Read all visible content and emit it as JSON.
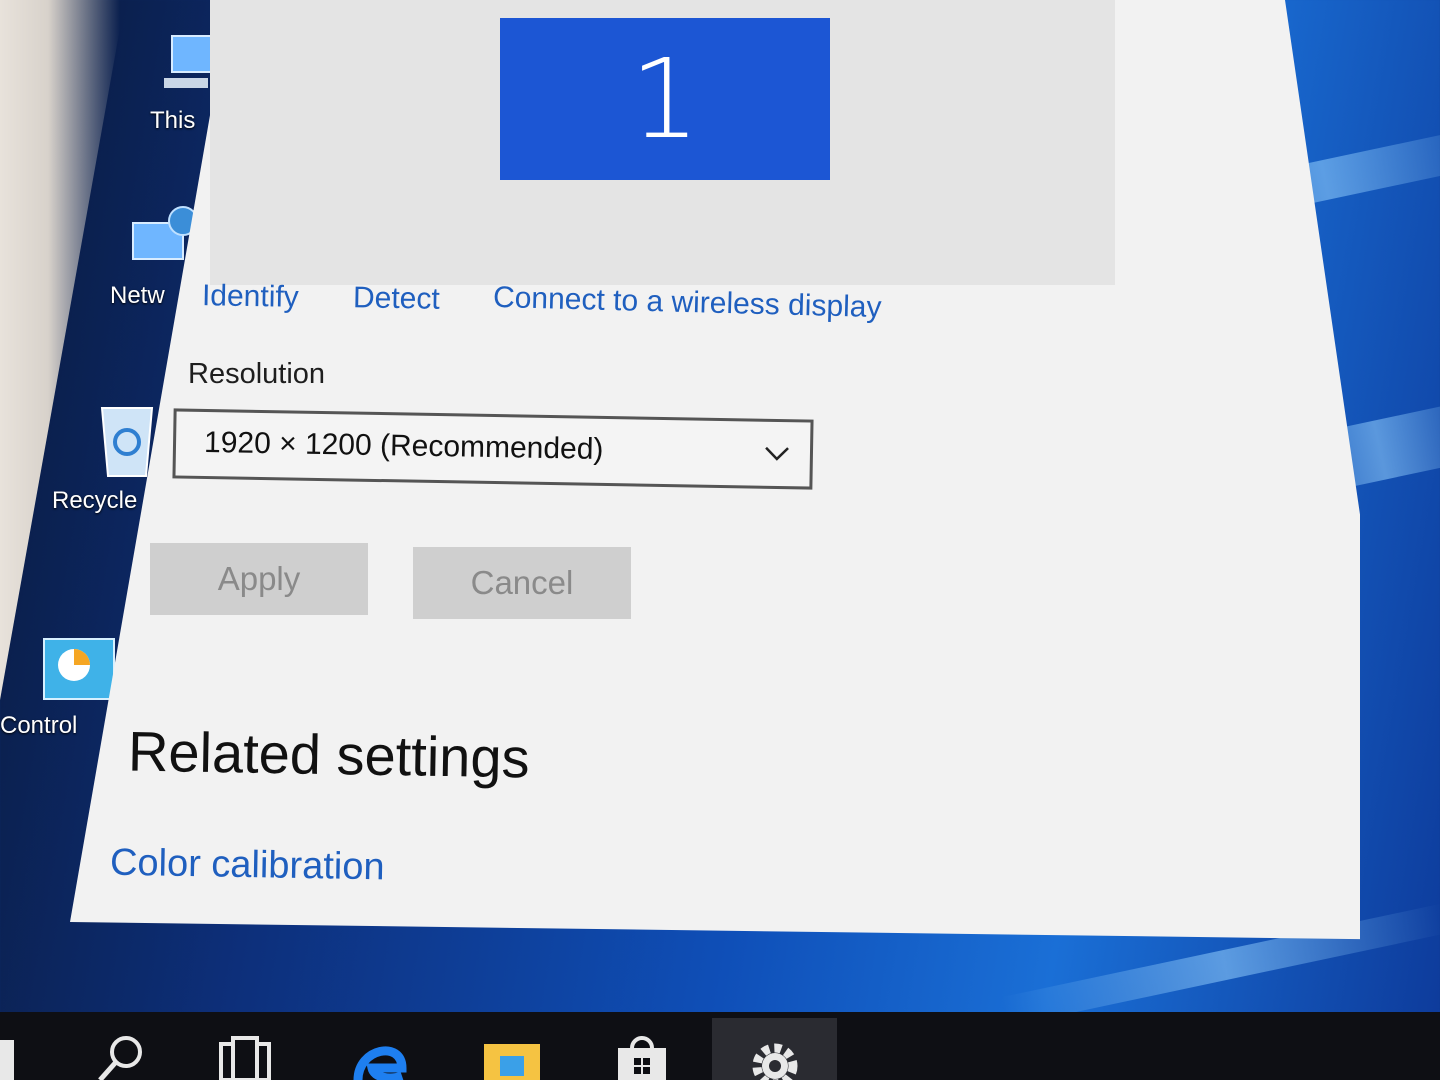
{
  "desktop": {
    "icons": [
      {
        "label": "This"
      },
      {
        "label": "Netw"
      },
      {
        "label": "Recycle"
      },
      {
        "label": "Control"
      }
    ]
  },
  "display_settings": {
    "monitor_number": "1",
    "links": {
      "identify": "Identify",
      "detect": "Detect",
      "connect_wireless": "Connect to a wireless display"
    },
    "resolution": {
      "label": "Resolution",
      "selected": "1920 × 1200 (Recommended)"
    },
    "buttons": {
      "apply": "Apply",
      "cancel": "Cancel"
    },
    "related": {
      "heading": "Related settings",
      "color_calibration": "Color calibration"
    }
  },
  "taskbar": {
    "items": [
      "start-icon",
      "search-icon",
      "task-view-icon",
      "edge-icon",
      "file-explorer-icon",
      "store-icon",
      "settings-icon"
    ],
    "active": "settings-icon"
  },
  "colors": {
    "accent": "#1f5fbf",
    "monitor_tile": "#1c56d4",
    "window_bg": "#f2f2f2",
    "taskbar_bg": "#0e0f14"
  }
}
